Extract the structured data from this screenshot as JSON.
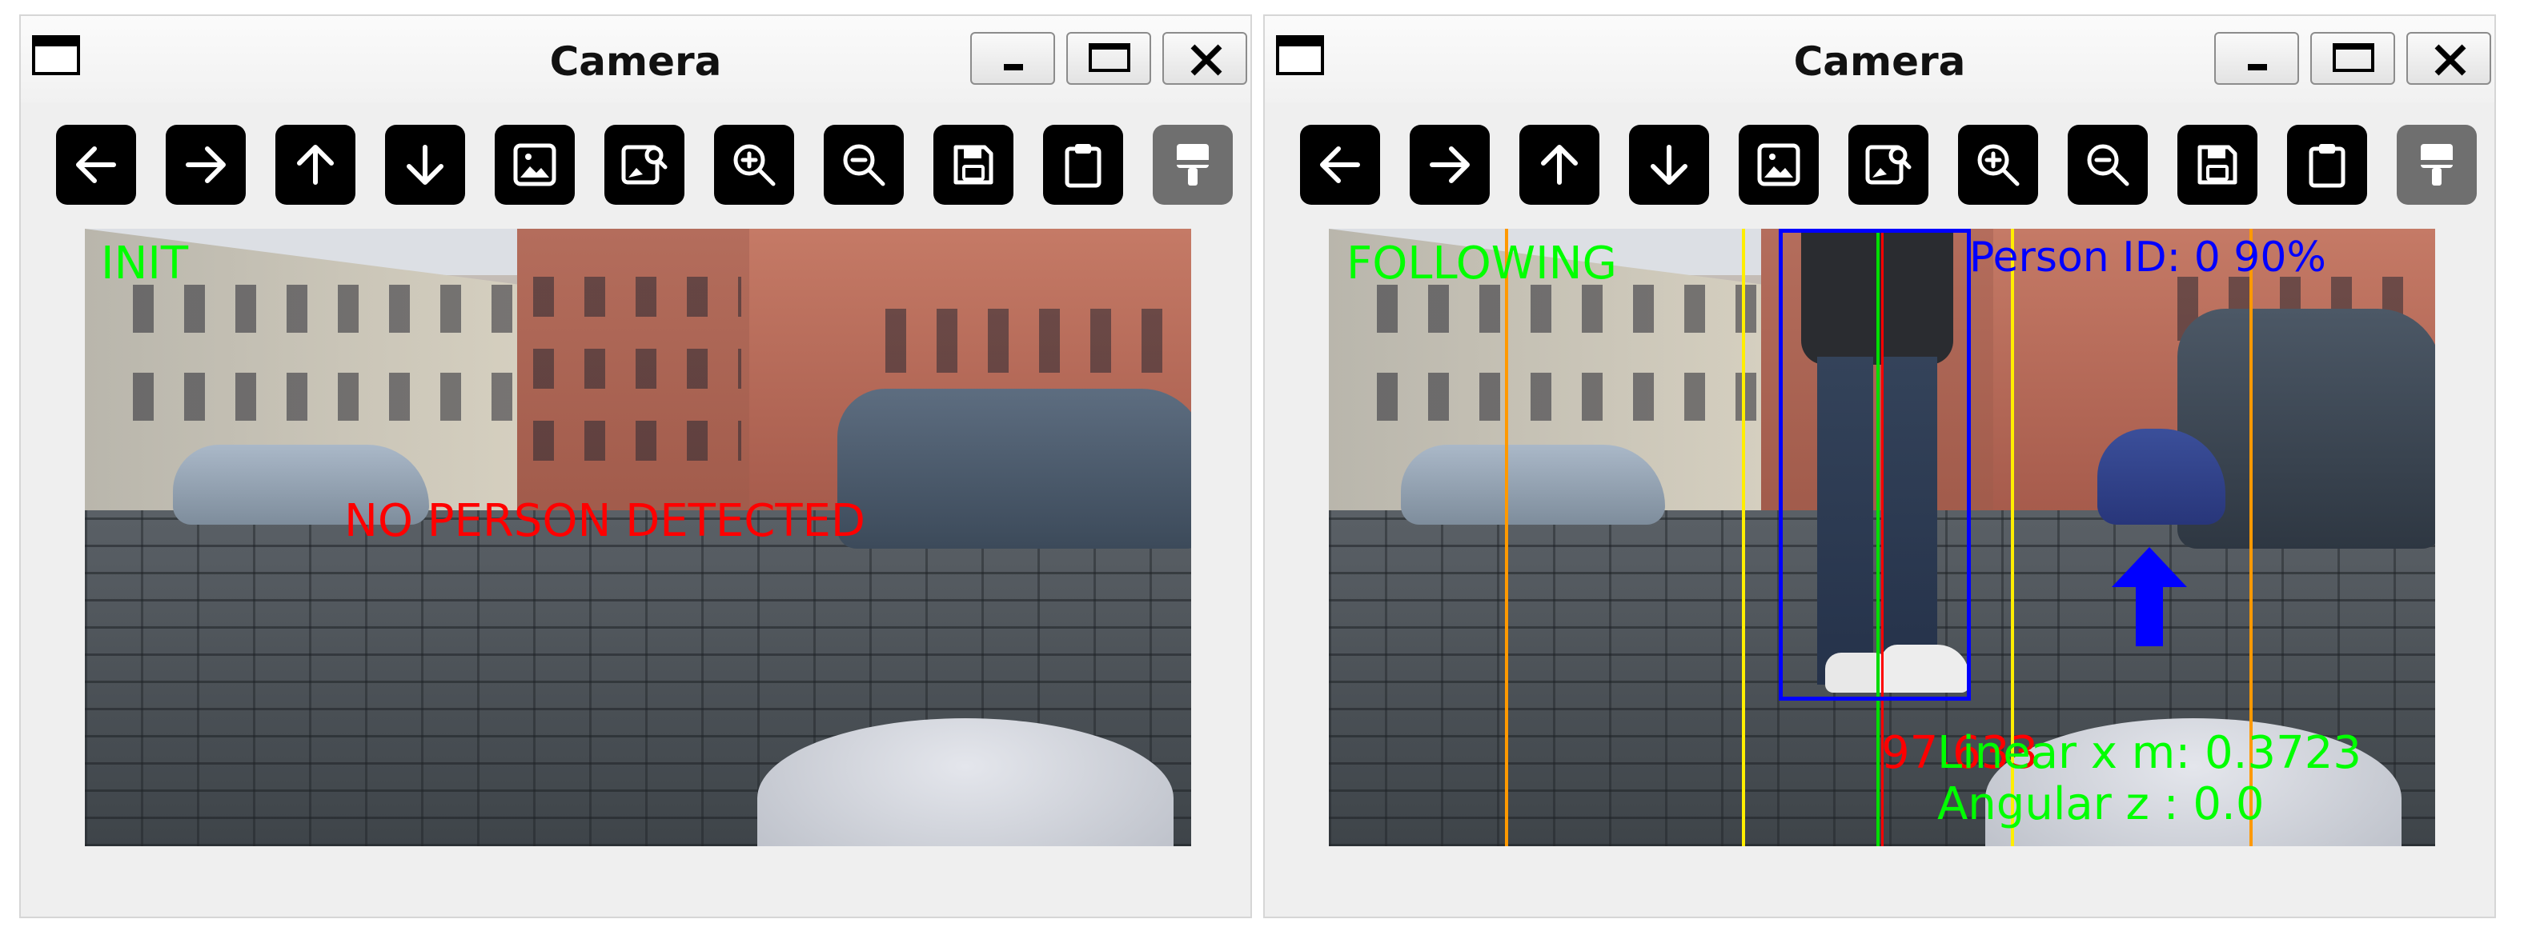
{
  "windows": [
    {
      "title": "Camera",
      "toolbar": [
        "arrow-left",
        "arrow-right",
        "arrow-up",
        "arrow-down",
        "image",
        "image-search",
        "zoom-in",
        "zoom-out",
        "save",
        "clipboard",
        "paint-brush"
      ],
      "overlay": {
        "state": "INIT",
        "message": "NO PERSON DETECTED"
      }
    },
    {
      "title": "Camera",
      "toolbar": [
        "arrow-left",
        "arrow-right",
        "arrow-up",
        "arrow-down",
        "image",
        "image-search",
        "zoom-in",
        "zoom-out",
        "save",
        "clipboard",
        "paint-brush"
      ],
      "overlay": {
        "state": "FOLLOWING",
        "person_id": "Person ID: 0 90%",
        "red_reading": "97.633",
        "linear": "Linear x m: 0.3723",
        "angular": "Angular z : 0.0"
      }
    }
  ],
  "colors": {
    "status_green": "#00ff00",
    "alert_red": "#ff0000",
    "bbox_blue": "#0000ff",
    "guide_orange": "#ff9900",
    "guide_yellow": "#ffee00"
  }
}
